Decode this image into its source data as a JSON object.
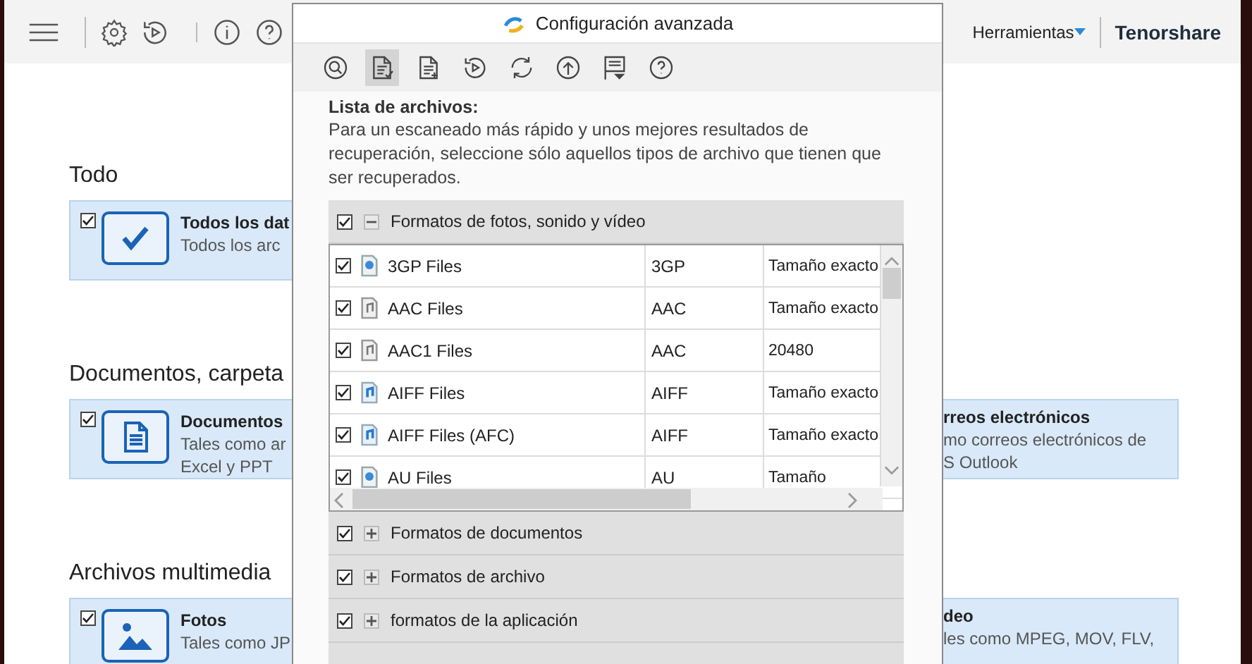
{
  "top_bar": {
    "menu": "Herramientas",
    "brand": "Tenorshare"
  },
  "sections": [
    {
      "title": "Todo",
      "left_card": {
        "kind": "all",
        "checked": true,
        "title": "Todos los dat",
        "lines": [
          "Todos los arc"
        ]
      }
    },
    {
      "title": "Documentos, carpeta",
      "left_card": {
        "kind": "documents",
        "checked": true,
        "title": "Documentos",
        "lines": [
          "Tales como ar",
          "Excel y PPT"
        ]
      },
      "right_card": {
        "title": "rreos electrónicos",
        "lines": [
          "mo correos electrónicos de",
          "S Outlook"
        ]
      }
    },
    {
      "title": "Archivos multimedia",
      "left_card": {
        "kind": "photos",
        "checked": true,
        "title": "Fotos",
        "lines": [
          "Tales como JP"
        ]
      },
      "right_card": {
        "title": "deo",
        "lines": [
          "les como MPEG, MOV, FLV,"
        ]
      }
    }
  ],
  "dialog": {
    "title": "Configuración avanzada",
    "tools": [
      {
        "kind": "search",
        "selected": false
      },
      {
        "kind": "file-check",
        "selected": true
      },
      {
        "kind": "file-plus",
        "selected": false
      },
      {
        "kind": "history",
        "selected": false
      },
      {
        "kind": "sync",
        "selected": false
      },
      {
        "kind": "upload",
        "selected": false
      },
      {
        "kind": "flag",
        "selected": false
      },
      {
        "kind": "help",
        "selected": false
      }
    ],
    "heading": "Lista de archivos:",
    "description": "Para un escaneado más rápido y unos mejores resultados de recuperación, seleccione sólo aquellos tipos de archivo que tienen que ser recuperados.",
    "groups": [
      {
        "label": "Formatos de fotos, sonido y vídeo",
        "checked": true,
        "expanded": true,
        "files": [
          {
            "kind": "video",
            "checked": true,
            "name": "3GP Files",
            "ext": "3GP",
            "size": "Tamaño exacto"
          },
          {
            "kind": "audio",
            "checked": true,
            "name": "AAC Files",
            "ext": "AAC",
            "size": "Tamaño exacto"
          },
          {
            "kind": "audio",
            "checked": true,
            "name": "AAC1 Files",
            "ext": "AAC",
            "size": "20480"
          },
          {
            "kind": "music",
            "checked": true,
            "name": "AIFF Files",
            "ext": "AIFF",
            "size": "Tamaño exacto"
          },
          {
            "kind": "music",
            "checked": true,
            "name": "AIFF Files (AFC)",
            "ext": "AIFF",
            "size": "Tamaño exacto"
          },
          {
            "kind": "video",
            "checked": true,
            "name": "AU Files",
            "ext": "AU",
            "size": "Tamaño"
          }
        ]
      },
      {
        "label": "Formatos de documentos",
        "checked": true,
        "expanded": false
      },
      {
        "label": "Formatos de archivo",
        "checked": true,
        "expanded": false
      },
      {
        "label": "formatos de la aplicación",
        "checked": true,
        "expanded": false
      }
    ]
  }
}
